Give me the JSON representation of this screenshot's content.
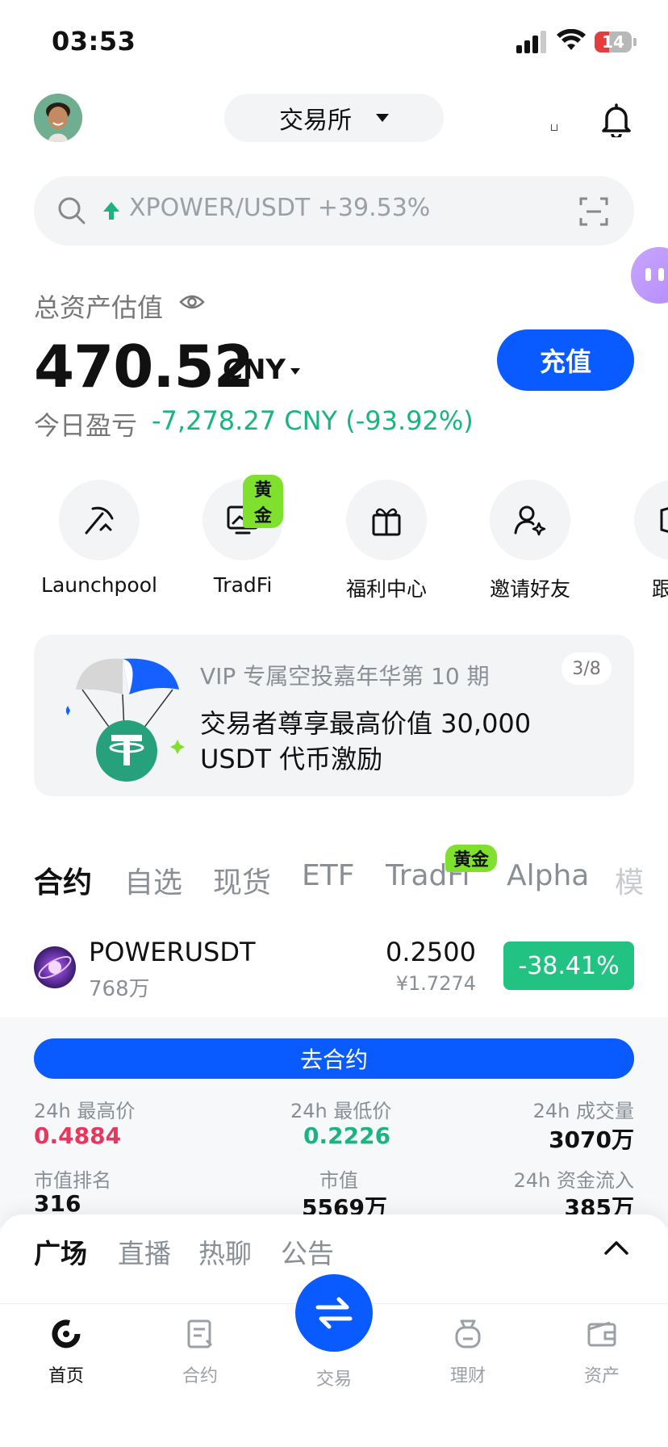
{
  "status_bar": {
    "time": "03:53",
    "battery": "14"
  },
  "header": {
    "exchange_label": "交易所"
  },
  "search": {
    "trending": "XPOWER/USDT +39.53%"
  },
  "assets": {
    "label": "总资产估值",
    "value": "470.52",
    "unit": "CNY",
    "deposit_label": "充值",
    "pnl_label": "今日盈亏",
    "pnl_value": "-7,278.27 CNY (-93.92%)"
  },
  "shortcuts": [
    {
      "label": "Launchpool"
    },
    {
      "label": "TradFi",
      "badge": "黄金"
    },
    {
      "label": "福利中心"
    },
    {
      "label": "邀请好友"
    },
    {
      "label": "跟"
    }
  ],
  "banner": {
    "subtitle": "VIP 专属空投嘉年华第 10 期",
    "title": "交易者尊享最高价值 30,000 USDT 代币激励",
    "page": "3/8"
  },
  "market_tabs": [
    {
      "label": "合约",
      "active": true
    },
    {
      "label": "自选"
    },
    {
      "label": "现货"
    },
    {
      "label": "ETF"
    },
    {
      "label": "TradFi",
      "badge": "黄金"
    },
    {
      "label": "Alpha"
    },
    {
      "label": "模"
    }
  ],
  "market_row": {
    "symbol": "POWERUSDT",
    "volume": "768万",
    "price": "0.2500",
    "price_cny": "¥1.7274",
    "change": "-38.41%"
  },
  "detail": {
    "go_label": "去合约",
    "stats": [
      {
        "label": "24h 最高价",
        "value": "0.4884",
        "color": "#e8365d"
      },
      {
        "label": "24h 最低价",
        "value": "0.2226",
        "color": "#1ab47f"
      },
      {
        "label": "24h 成交量",
        "value": "3070万"
      },
      {
        "label": "市值排名",
        "value": "316"
      },
      {
        "label": "市值",
        "value": "5569万"
      },
      {
        "label": "24h 资金流入",
        "value": "385万"
      }
    ]
  },
  "feed_tabs": [
    {
      "label": "广场",
      "active": true
    },
    {
      "label": "直播"
    },
    {
      "label": "热聊"
    },
    {
      "label": "公告"
    }
  ],
  "nav": [
    {
      "label": "首页",
      "active": true,
      "icon": "home-icon"
    },
    {
      "label": "合约",
      "icon": "contract-icon"
    },
    {
      "label": "交易",
      "icon": "trade-icon"
    },
    {
      "label": "理财",
      "icon": "earn-icon"
    },
    {
      "label": "资产",
      "icon": "wallet-icon"
    }
  ],
  "colors": {
    "accent": "#0a5bff",
    "up": "#22c283",
    "down": "#e8365d"
  }
}
